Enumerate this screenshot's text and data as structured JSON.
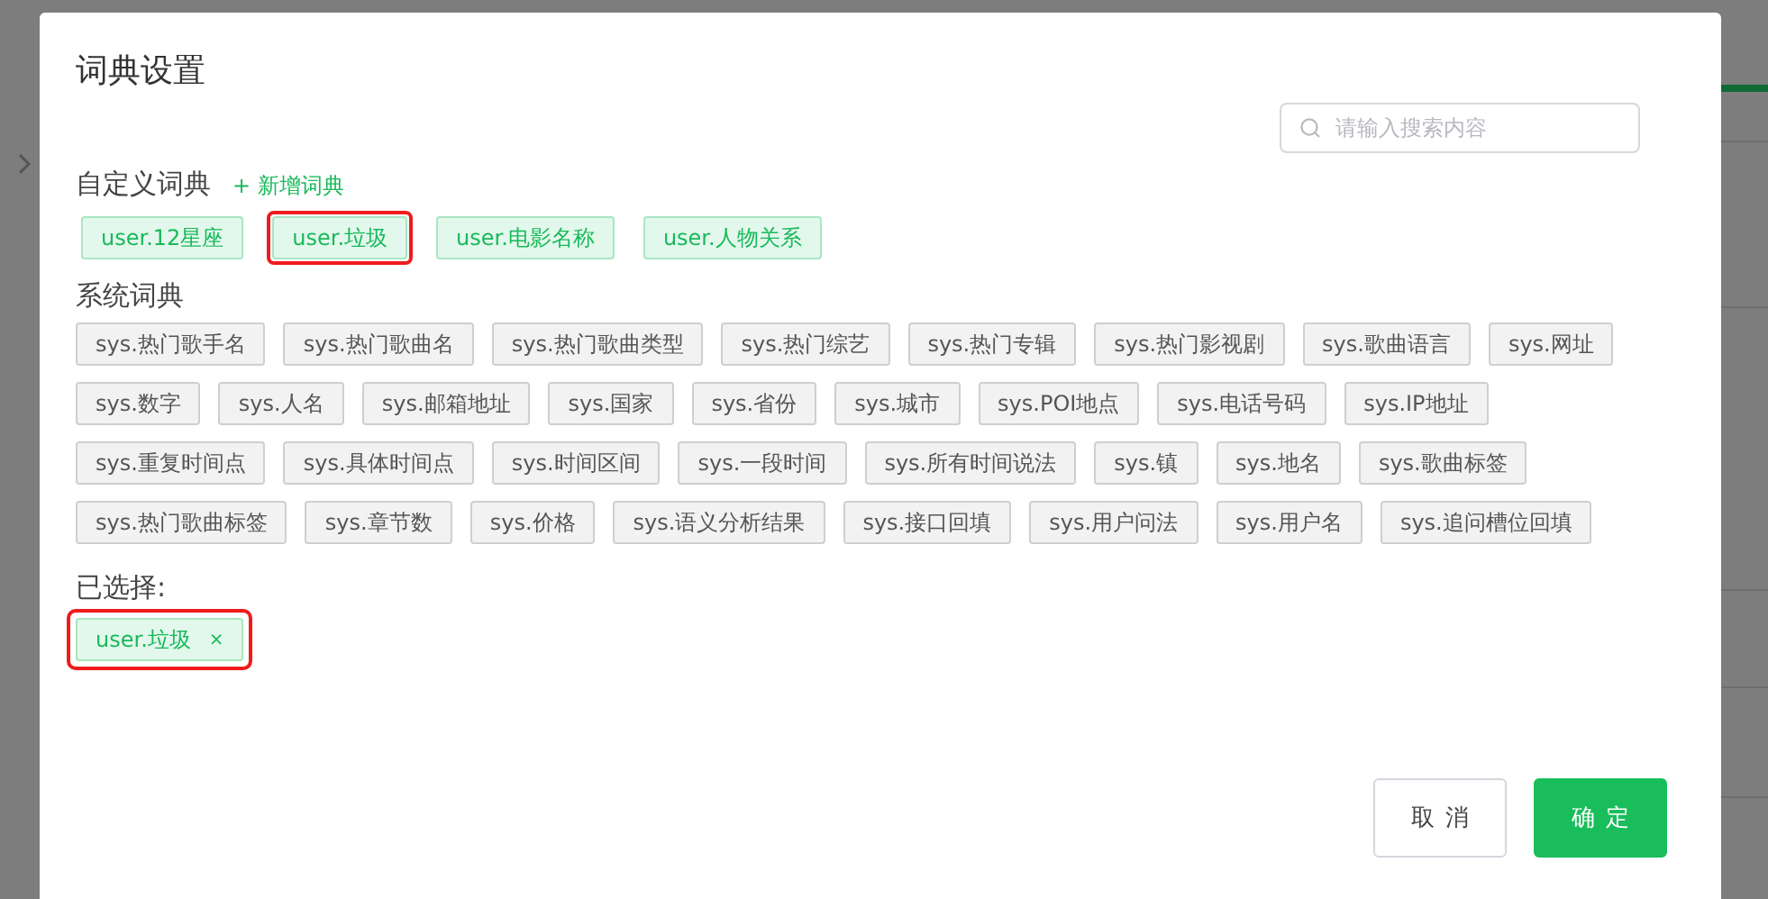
{
  "dialog": {
    "title": "词典设置"
  },
  "search": {
    "placeholder": "请输入搜索内容"
  },
  "custom": {
    "label": "自定义词典",
    "add_link": "+ 新增词典",
    "tags": [
      {
        "label": "user.12星座",
        "selected": false
      },
      {
        "label": "user.垃圾",
        "selected": true
      },
      {
        "label": "user.电影名称",
        "selected": false
      },
      {
        "label": "user.人物关系",
        "selected": false
      }
    ]
  },
  "system": {
    "label": "系统词典",
    "tags": [
      "sys.热门歌手名",
      "sys.热门歌曲名",
      "sys.热门歌曲类型",
      "sys.热门综艺",
      "sys.热门专辑",
      "sys.热门影视剧",
      "sys.歌曲语言",
      "sys.网址",
      "sys.数字",
      "sys.人名",
      "sys.邮箱地址",
      "sys.国家",
      "sys.省份",
      "sys.城市",
      "sys.POI地点",
      "sys.电话号码",
      "sys.IP地址",
      "sys.重复时间点",
      "sys.具体时间点",
      "sys.时间区间",
      "sys.一段时间",
      "sys.所有时间说法",
      "sys.镇",
      "sys.地名",
      "sys.歌曲标签",
      "sys.热门歌曲标签",
      "sys.章节数",
      "sys.价格",
      "sys.语义分析结果",
      "sys.接口回填",
      "sys.用户问法",
      "sys.用户名",
      "sys.追问槽位回填"
    ]
  },
  "chosen": {
    "label": "已选择:",
    "items": [
      {
        "label": "user.垃圾",
        "remove": "×",
        "highlighted": true
      }
    ]
  },
  "buttons": [
    {
      "label": "取消",
      "kind": "secondary"
    },
    {
      "label": "确定",
      "kind": "primary"
    }
  ]
}
